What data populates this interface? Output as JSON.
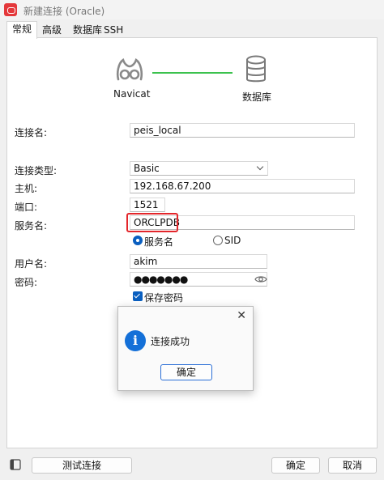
{
  "window": {
    "title": "新建连接 (Oracle)"
  },
  "tabs": [
    {
      "label": "常规",
      "active": true
    },
    {
      "label": "高级"
    },
    {
      "label": "数据库"
    },
    {
      "label": "SSH"
    }
  ],
  "diagram": {
    "left_label": "Navicat",
    "right_label": "数据库",
    "line_color": "#3cc24e"
  },
  "form": {
    "connection_name": {
      "label": "连接名:",
      "value": "peis_local"
    },
    "connection_type": {
      "label": "连接类型:",
      "value": "Basic"
    },
    "host": {
      "label": "主机:",
      "value": "192.168.67.200"
    },
    "port": {
      "label": "端口:",
      "value": "1521"
    },
    "service_name": {
      "label": "服务名:",
      "value": "ORCLPDB",
      "options": [
        {
          "label": "服务名",
          "checked": true
        },
        {
          "label": "SID",
          "checked": false
        }
      ]
    },
    "username": {
      "label": "用户名:",
      "value": "akim"
    },
    "password": {
      "label": "密码:",
      "value": "●●●●●●●"
    },
    "save_password": {
      "label": "保存密码",
      "checked": true
    }
  },
  "dialog": {
    "message": "连接成功",
    "ok_label": "确定",
    "close_symbol": "✕"
  },
  "footer": {
    "test_label": "测试连接",
    "ok_label": "确定",
    "cancel_label": "取消"
  },
  "colors": {
    "accent": "#0a5fc0",
    "highlight": "#e3262b",
    "info": "#1470d8"
  }
}
